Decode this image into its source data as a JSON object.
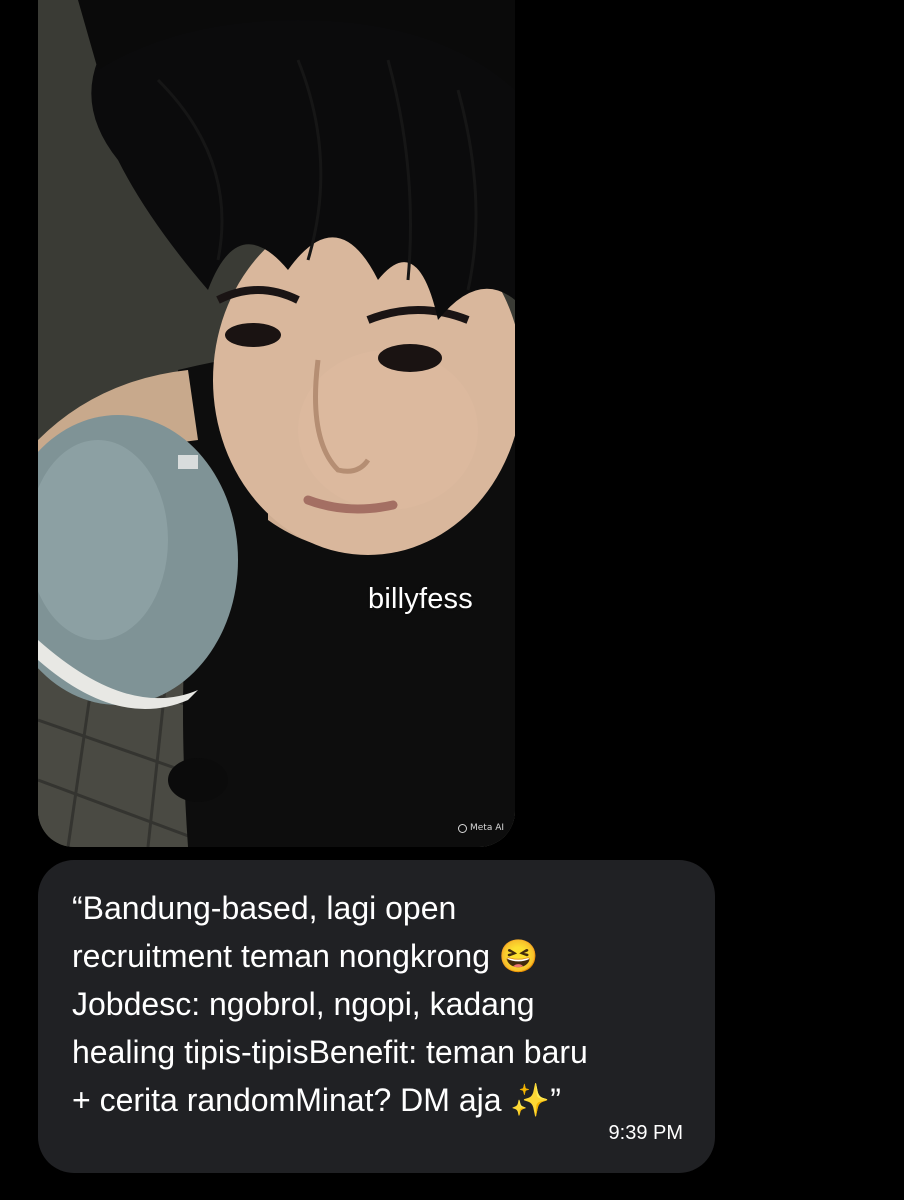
{
  "conversation": {
    "photo_message": {
      "watermark_label": "billyfess",
      "ai_badge": "Meta AI",
      "ai_badge_icon": "meta-ai-ring-icon"
    },
    "text_message": {
      "body": "“Bandung-based, lagi open\nrecruitment teman nongkrong 😆\nJobdesc: ngobrol, ngopi, kadang\nhealing tipis-tipisBenefit: teman baru\n+ cerita randomMinat? DM aja ✨”",
      "timestamp": "9:39 PM"
    }
  },
  "colors": {
    "background": "#000000",
    "bubble": "#202124",
    "text": "#ffffff"
  }
}
